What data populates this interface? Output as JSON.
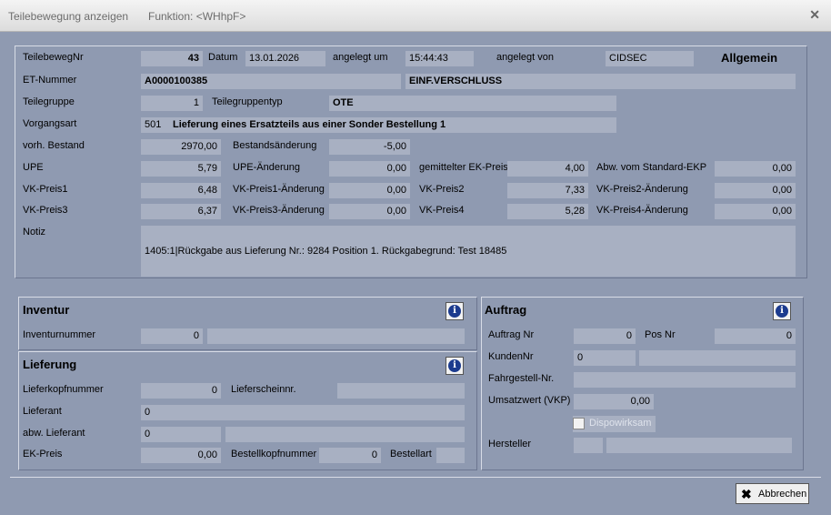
{
  "window": {
    "title": "Teilebewegung anzeigen",
    "function": "Funktion: <WHhpF>"
  },
  "allgemein": {
    "section_title": "Allgemein",
    "teilebewegnr_label": "TeilebewegNr",
    "teilebewegnr": "43",
    "datum_label": "Datum",
    "datum": "13.01.2026",
    "angelegt_um_label": "angelegt um",
    "angelegt_um": "15:44:43",
    "angelegt_von_label": "angelegt von",
    "angelegt_von": "CIDSEC",
    "et_nummer_label": "ET-Nummer",
    "et_nummer": "A0000100385",
    "et_bezeichnung": "EINF.VERSCHLUSS",
    "teilegruppe_label": "Teilegruppe",
    "teilegruppe": "1",
    "teilegruppentyp_label": "Teilegruppentyp",
    "teilegruppentyp": "OTE",
    "vorgangsart_label": "Vorgangsart",
    "vorgangsart_code": "501",
    "vorgangsart_text": "Lieferung eines Ersatzteils aus einer Sonder Bestellung 1",
    "vorh_bestand_label": "vorh. Bestand",
    "vorh_bestand": "2970,00",
    "bestandsaenderung_label": "Bestandsänderung",
    "bestandsaenderung": "-5,00",
    "upe_label": "UPE",
    "upe": "5,79",
    "upe_aenderung_label": "UPE-Änderung",
    "upe_aenderung": "0,00",
    "gemittelter_ek_label": "gemittelter EK-Preis",
    "gemittelter_ek": "4,00",
    "abw_standard_ekp_label": "Abw. vom Standard-EKP",
    "abw_standard_ekp": "0,00",
    "vk1_label": "VK-Preis1",
    "vk1": "6,48",
    "vk1_aend_label": "VK-Preis1-Änderung",
    "vk1_aend": "0,00",
    "vk2_label": "VK-Preis2",
    "vk2": "7,33",
    "vk2_aend_label": "VK-Preis2-Änderung",
    "vk2_aend": "0,00",
    "vk3_label": "VK-Preis3",
    "vk3": "6,37",
    "vk3_aend_label": "VK-Preis3-Änderung",
    "vk3_aend": "0,00",
    "vk4_label": "VK-Preis4",
    "vk4": "5,28",
    "vk4_aend_label": "VK-Preis4-Änderung",
    "vk4_aend": "0,00",
    "notiz_label": "Notiz",
    "notiz": "1405:1|Rückgabe aus Lieferung Nr.: 9284 Position 1. Rückgabegrund: Test 18485"
  },
  "inventur": {
    "title": "Inventur",
    "inventurnummer_label": "Inventurnummer",
    "inventurnummer": "0"
  },
  "lieferung": {
    "title": "Lieferung",
    "lieferkopfnummer_label": "Lieferkopfnummer",
    "lieferkopfnummer": "0",
    "lieferscheinnr_label": "Lieferscheinnr.",
    "lieferscheinnr": "",
    "lieferant_label": "Lieferant",
    "lieferant": "0",
    "abw_lieferant_label": "abw. Lieferant",
    "abw_lieferant": "0",
    "ek_preis_label": "EK-Preis",
    "ek_preis": "0,00",
    "bestellkopfnummer_label": "Bestellkopfnummer",
    "bestellkopfnummer": "0",
    "bestellart_label": "Bestellart",
    "bestellart": ""
  },
  "auftrag": {
    "title": "Auftrag",
    "auftrag_nr_label": "Auftrag Nr",
    "auftrag_nr": "0",
    "pos_nr_label": "Pos Nr",
    "pos_nr": "0",
    "kunden_nr_label": "KundenNr",
    "kunden_nr": "0",
    "fahrgestell_label": "Fahrgestell-Nr.",
    "fahrgestell": "",
    "umsatzwert_label": "Umsatzwert (VKP)",
    "umsatzwert": "0,00",
    "dispowirksam_label": "Dispowirksam",
    "dispowirksam_checked": false,
    "hersteller_label": "Hersteller",
    "hersteller": ""
  },
  "footer": {
    "abbrechen_label": "Abbrechen"
  },
  "icons": {
    "info": "info-icon",
    "close": "close-icon",
    "cancel": "x-icon"
  }
}
